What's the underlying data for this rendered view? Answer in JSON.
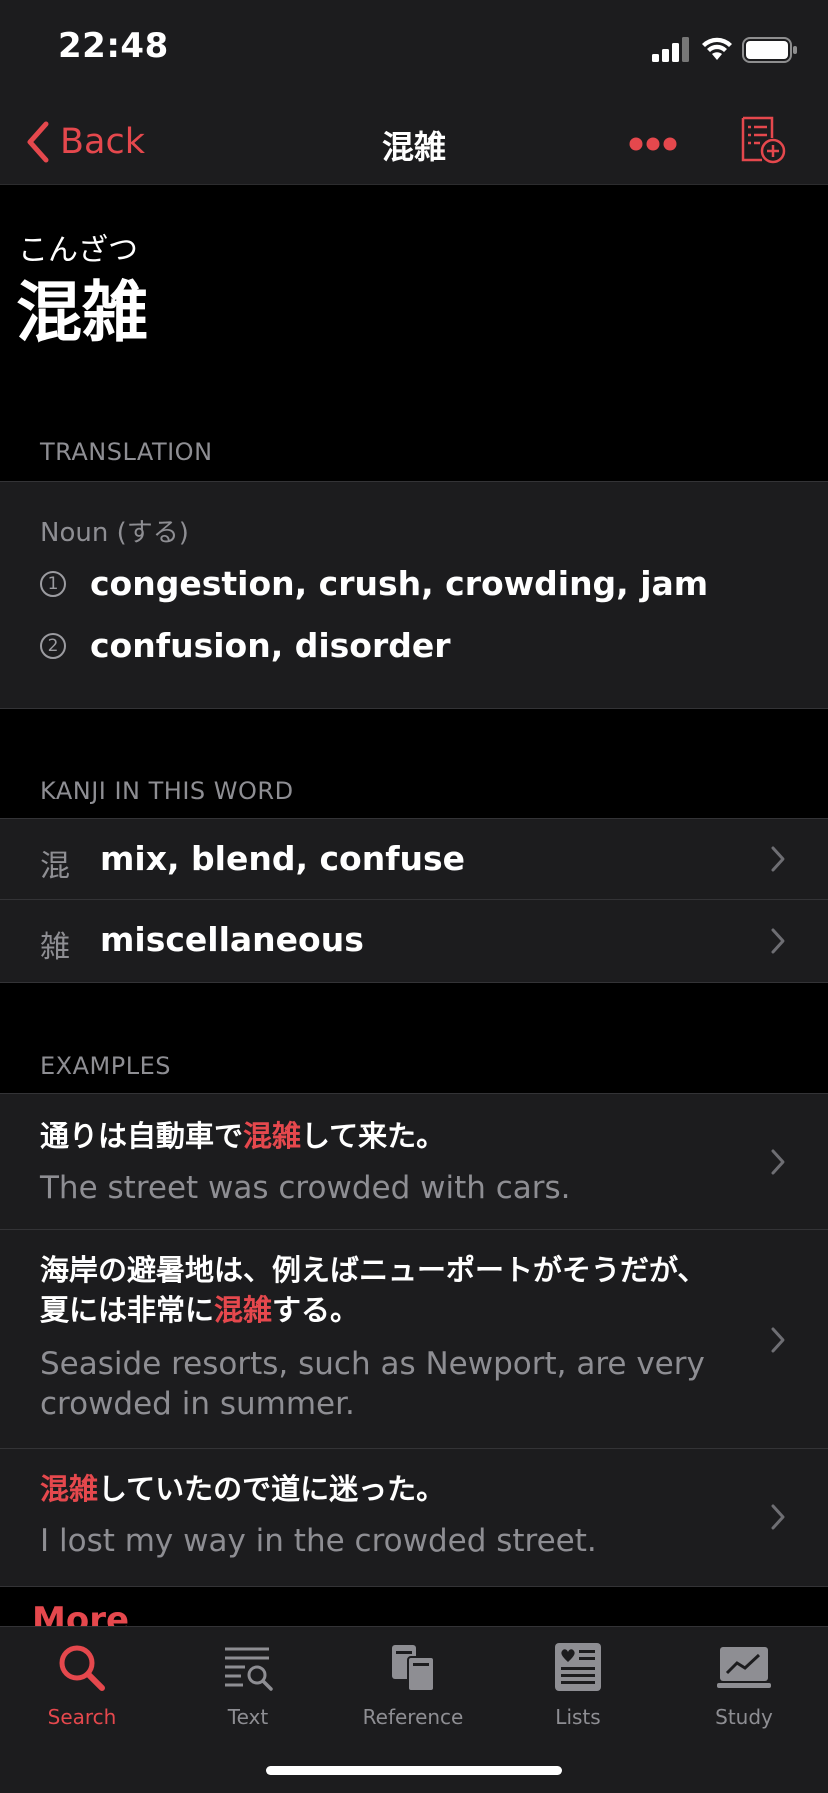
{
  "status_bar": {
    "time": "22:48"
  },
  "nav": {
    "back_label": "Back",
    "title": "混雑"
  },
  "entry": {
    "reading": "こんざつ",
    "word": "混雑"
  },
  "translation": {
    "section_label": "TRANSLATION",
    "part_of_speech": "Noun (する)",
    "senses": [
      {
        "num": "1",
        "gloss": "congestion, crush, crowding, jam"
      },
      {
        "num": "2",
        "gloss": "confusion, disorder"
      }
    ]
  },
  "kanji": {
    "section_label": "KANJI IN THIS WORD",
    "items": [
      {
        "char": "混",
        "meaning": "mix, blend, confuse"
      },
      {
        "char": "雑",
        "meaning": "miscellaneous"
      }
    ]
  },
  "examples": {
    "section_label": "EXAMPLES",
    "items": [
      {
        "jp_before": "通りは自動車で",
        "jp_highlight": "混雑",
        "jp_after": "して来た。",
        "en": "The street was crowded with cars."
      },
      {
        "jp_before": "海岸の避暑地は、例えばニューポートがそうだが、夏には非常に",
        "jp_highlight": "混雑",
        "jp_after": "する。",
        "en": "Seaside resorts, such as Newport, are very crowded in summer."
      },
      {
        "jp_before": "",
        "jp_highlight": "混雑",
        "jp_after": "していたので道に迷った。",
        "en": "I lost my way in the crowded street."
      }
    ],
    "more_label": "More"
  },
  "tabs": [
    {
      "label": "Search",
      "icon": "search-icon",
      "active": true
    },
    {
      "label": "Text",
      "icon": "text-search-icon",
      "active": false
    },
    {
      "label": "Reference",
      "icon": "reference-books-icon",
      "active": false
    },
    {
      "label": "Lists",
      "icon": "lists-icon",
      "active": false
    },
    {
      "label": "Study",
      "icon": "study-chart-icon",
      "active": false
    }
  ],
  "colors": {
    "accent": "#e5484d",
    "background": "#000000",
    "card": "#1c1c1e",
    "secondary_text": "#8e8e93"
  }
}
